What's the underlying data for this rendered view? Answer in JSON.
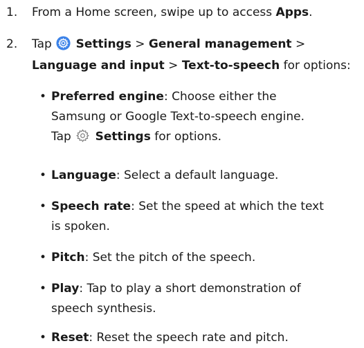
{
  "steps": [
    {
      "number": "1.",
      "text_before": "From a Home screen, swipe up to access ",
      "bold_apps": "Apps",
      "text_after": "."
    },
    {
      "number": "2.",
      "tap": "Tap",
      "settings": "Settings",
      "sep1": ">",
      "general": "General management",
      "sep2": ">",
      "language_input": "Language and input",
      "sep3": ">",
      "tts": "Text-to-speech",
      "for_options": " for options:"
    }
  ],
  "options": [
    {
      "term": "Preferred engine",
      "desc_line1": ": Choose either the",
      "desc_line2": "Samsung or Google Text-to-speech engine.",
      "tap": "Tap",
      "settings": "Settings",
      "for_options": " for options."
    },
    {
      "term": "Language",
      "desc": ": Select a default language."
    },
    {
      "term": "Speech rate",
      "desc_line1": ": Set the speed at which the text",
      "desc_line2": "is spoken."
    },
    {
      "term": "Pitch",
      "desc": ": Set the pitch of the speech."
    },
    {
      "term": "Play",
      "desc_line1": ": Tap to play a short demonstration of",
      "desc_line2": "speech synthesis."
    },
    {
      "term": "Reset",
      "desc": ": Reset the speech rate and pitch."
    }
  ],
  "icons": {
    "settings_color": "#3b82e8",
    "settings_outline_color": "#777777"
  },
  "bullet_char": "•"
}
